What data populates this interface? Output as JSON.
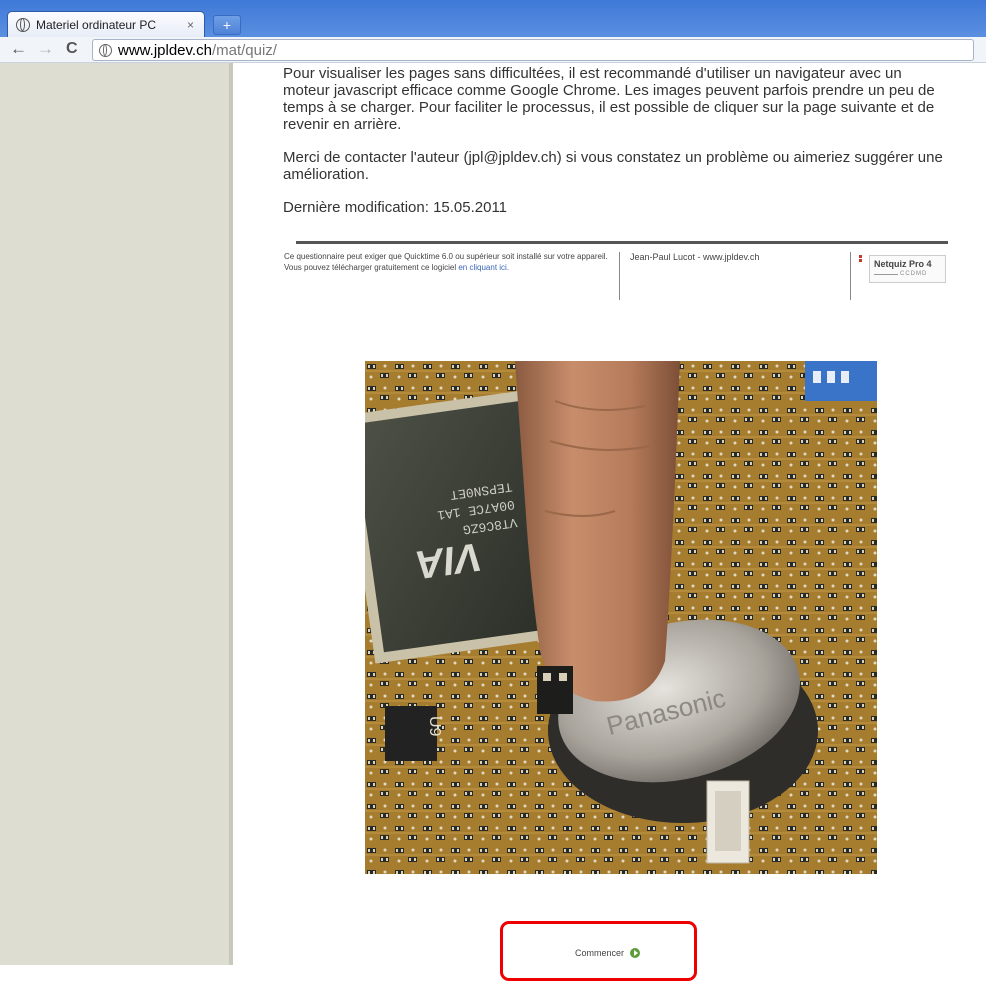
{
  "browser": {
    "tab_title": "Materiel ordinateur PC",
    "tab_close": "×",
    "new_tab": "+",
    "back": "←",
    "forward": "→",
    "reload": "C",
    "url_host": "www.jpldev.ch",
    "url_path": "/mat/quiz/"
  },
  "page": {
    "intro_1": "Pour visualiser les pages sans difficultées, il est recommandé d'utiliser un navigateur avec un moteur javascript efficace comme Google Chrome. Les images peuvent parfois prendre un peu de temps à se charger. Pour faciliter le processus, il est possible de cliquer sur la page suivante et de revenir en arrière.",
    "intro_2": "Merci de contacter l'auteur (jpl@jpldev.ch) si vous constatez un problème ou aimeriez suggérer une amélioration.",
    "last_modified": "Dernière modification: 15.05.2011"
  },
  "footer": {
    "quicktime_text": "Ce questionnaire peut exiger que Quicktime 6.0 ou supérieur soit installé sur votre appareil. Vous pouvez télécharger gratuitement ce logiciel",
    "link_text": "en cliquant ici.",
    "author": "Jean-Paul Lucot - www.jpldev.ch",
    "netquiz_name": "Netquiz Pro 4",
    "netquiz_org": "CCDMD"
  },
  "photo": {
    "chip_text_1": "VT8C6ZG",
    "chip_text_2": "00A7CE 1A1",
    "chip_text_3": "TEPSN0ET",
    "chip_logo": "VIA",
    "board_label": "U9",
    "battery_text": "Panasonic"
  },
  "start": {
    "label": "Commencer"
  }
}
